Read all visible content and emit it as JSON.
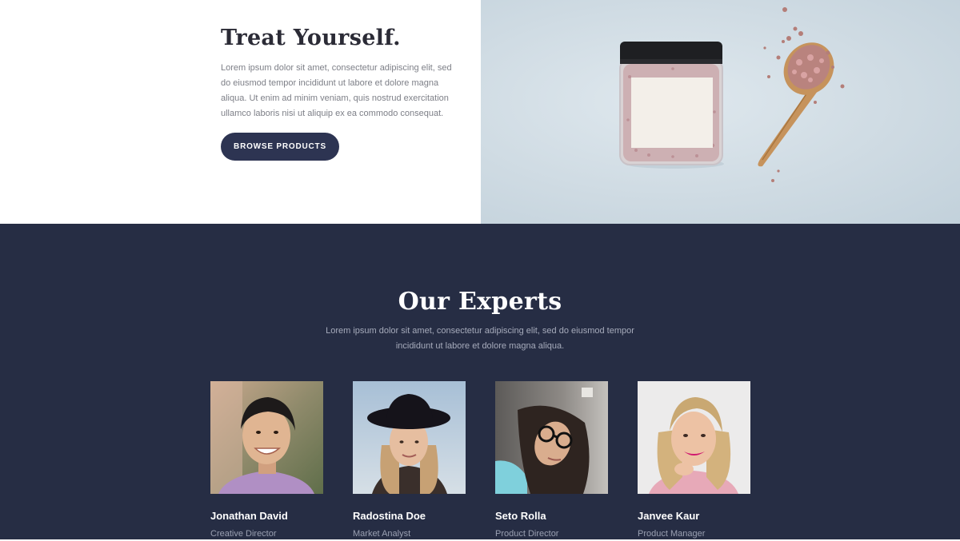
{
  "hero": {
    "title": "Treat Yourself.",
    "body": "Lorem ipsum dolor sit amet, consectetur adipiscing elit, sed do eiusmod tempor incididunt ut labore et dolore magna aliqua. Ut enim ad minim veniam, quis nostrud exercitation ullamco laboris nisi ut aliquip ex ea commodo consequat.",
    "button_label": "BROWSE PRODUCTS",
    "image_description": "jar-and-wooden-spoon-with-pink-salt"
  },
  "experts": {
    "title": "Our Experts",
    "subtitle": "Lorem ipsum dolor sit amet, consectetur adipiscing elit, sed do eiusmod tempor incididunt ut labore et dolore magna aliqua.",
    "members": [
      {
        "name": "Jonathan David",
        "role": "Creative Director"
      },
      {
        "name": "Radostina Doe",
        "role": "Market Analyst"
      },
      {
        "name": "Seto Rolla",
        "role": "Product Director"
      },
      {
        "name": "Janvee Kaur",
        "role": "Product Manager"
      }
    ]
  },
  "colors": {
    "navy": "#262d44",
    "button": "#2d3452",
    "text_dark": "#2b2b36",
    "text_muted": "#7d7f87"
  }
}
